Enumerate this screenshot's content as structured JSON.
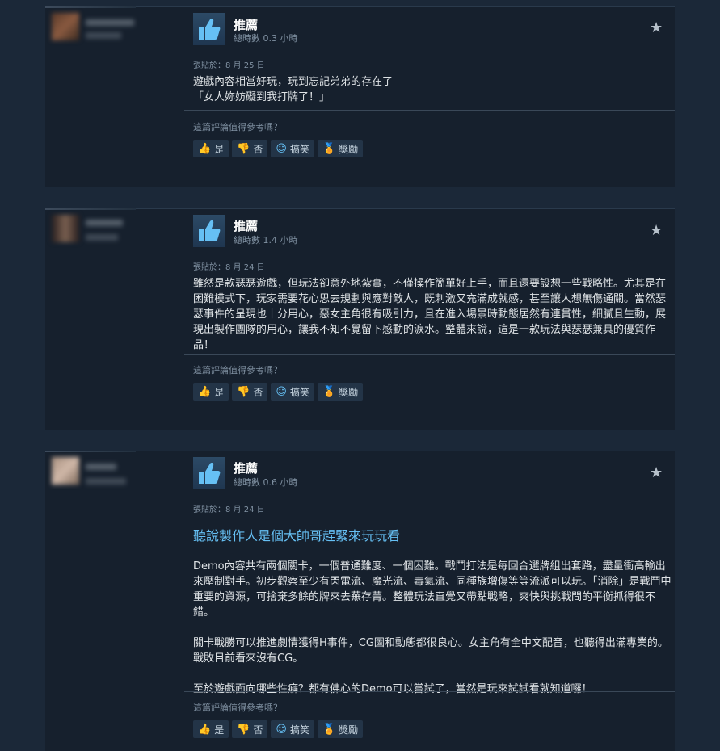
{
  "reviews": [
    {
      "recommendation": "推薦",
      "hours": "總時數 0.3 小時",
      "posted": "張貼於：8 月 25 日",
      "headline": "",
      "paragraphs": [
        "遊戲內容相當好玩，玩到忘記弟弟的存在了",
        "「女人妳妨礙到我打牌了！」"
      ],
      "helpful_question": "這篇評論值得參考嗎？",
      "buttons": {
        "yes": "是",
        "no": "否",
        "funny": "搞笑",
        "award": "獎勵"
      }
    },
    {
      "recommendation": "推薦",
      "hours": "總時數 1.4 小時",
      "posted": "張貼於：8 月 24 日",
      "headline": "",
      "paragraphs": [
        "雖然是款瑟瑟遊戲，但玩法卻意外地紮實，不僅操作簡單好上手，而且還要設想一些戰略性。尤其是在困難模式下，玩家需要花心思去規劃與應對敵人，既刺激又充滿成就感，甚至讓人想無傷通關。當然瑟瑟事件的呈現也十分用心，惡女主角很有吸引力，且在進入場景時動態居然有連貫性，細膩且生動，展現出製作團隊的用心，讓我不知不覺留下感動的淚水。整體來說，這是一款玩法與瑟瑟兼具的優質作品！"
      ],
      "helpful_question": "這篇評論值得參考嗎？",
      "buttons": {
        "yes": "是",
        "no": "否",
        "funny": "搞笑",
        "award": "獎勵"
      }
    },
    {
      "recommendation": "推薦",
      "hours": "總時數 0.6 小時",
      "posted": "張貼於：8 月 24 日",
      "headline": "聽說製作人是個大帥哥趕緊來玩玩看",
      "paragraphs": [
        "Demo內容共有兩個關卡，一個普通難度、一個困難。戰鬥打法是每回合選牌組出套路，盡量衝高輸出來壓制對手。初步觀察至少有閃電流、魔光流、毒氣流、同種族增傷等等流派可以玩。「消除」是戰鬥中重要的資源，可捨棄多餘的牌來去蕪存菁。整體玩法直覺又帶點戰略，爽快與挑戰間的平衡抓得很不錯。",
        "關卡戰勝可以推進劇情獲得H事件，CG圖和動態都很良心。女主角有全中文配音，也聽得出滿專業的。戰敗目前看來沒有CG。",
        "至於遊戲面向哪些性癖？都有佛心的Demo可以嘗試了，當然是玩來試試看就知道囉！"
      ],
      "helpful_question": "這篇評論值得參考嗎？",
      "buttons": {
        "yes": "是",
        "no": "否",
        "funny": "搞笑",
        "award": "獎勵"
      }
    }
  ],
  "colors": {
    "accent": "#66c0f4",
    "background": "#1b2838",
    "panel": "#16202d",
    "award": "#f5c03a"
  },
  "icons": {
    "thumb": "thumbs-up-icon",
    "star": "star-icon",
    "yes": "thumbs-up-icon",
    "no": "thumbs-down-icon",
    "funny": "smiley-icon",
    "award": "award-icon"
  }
}
